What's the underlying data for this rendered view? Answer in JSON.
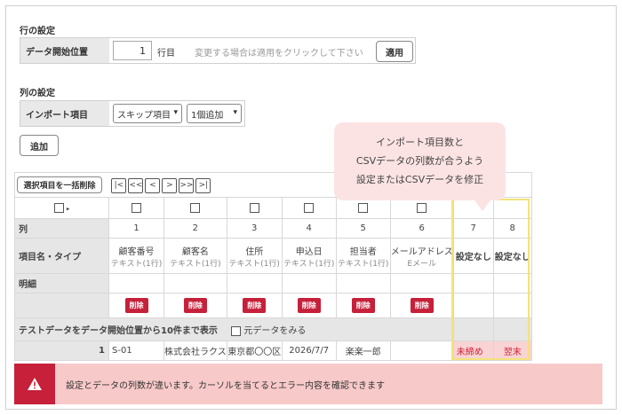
{
  "row_settings": {
    "title": "行の設定",
    "label": "データ開始位置",
    "start_value": "1",
    "unit": "行目",
    "hint": "変更する場合は適用をクリックして下さい",
    "apply_button": "適用"
  },
  "col_settings": {
    "title": "列の設定",
    "label": "インポート項目",
    "select_item": "スキップ項目",
    "select_count": "1個追加",
    "add_button": "追加"
  },
  "toolbar": {
    "bulk_delete": "選択項目を一括削除",
    "nav": [
      "|<",
      "<<",
      "<",
      ">",
      ">>",
      ">|"
    ]
  },
  "grid": {
    "row_labels": {
      "col": "列",
      "name_type": "項目名・タイプ",
      "detail": "明細"
    },
    "columns": [
      {
        "num": "1",
        "name": "顧客番号",
        "type": "テキスト(1行)"
      },
      {
        "num": "2",
        "name": "顧客名",
        "type": "テキスト(1行)"
      },
      {
        "num": "3",
        "name": "住所",
        "type": "テキスト(1行)"
      },
      {
        "num": "4",
        "name": "申込日",
        "type": "テキスト(1行)"
      },
      {
        "num": "5",
        "name": "担当者",
        "type": "テキスト(1行)"
      },
      {
        "num": "6",
        "name": "メールアドレス",
        "type": "Eメール"
      },
      {
        "num": "7",
        "name": "設定なし",
        "type": ""
      },
      {
        "num": "8",
        "name": "設定なし",
        "type": ""
      }
    ],
    "delete_label": "削除",
    "test_label": "テストデータをデータ開始位置から10件まで表示",
    "original_label": "元データをみる",
    "data_row": {
      "index": "1",
      "cells": [
        "S-01",
        "株式会社ラクス",
        "東京都〇〇区",
        "2026/7/7",
        "楽楽一郎",
        "",
        "未締め",
        "翌末"
      ]
    }
  },
  "tooltip": {
    "line1": "インポート項目数と",
    "line2": "CSVデータの列数が合うよう",
    "line3": "設定またはCSVデータを修正"
  },
  "error": {
    "icon": "warning-icon",
    "message": "設定とデータの列数が違います。カーソルを当てるとエラー内容を確認できます"
  },
  "colors": {
    "delete_red": "#c6203a",
    "highlight": "#f3e27a",
    "error_bg": "#f8c9c9"
  }
}
